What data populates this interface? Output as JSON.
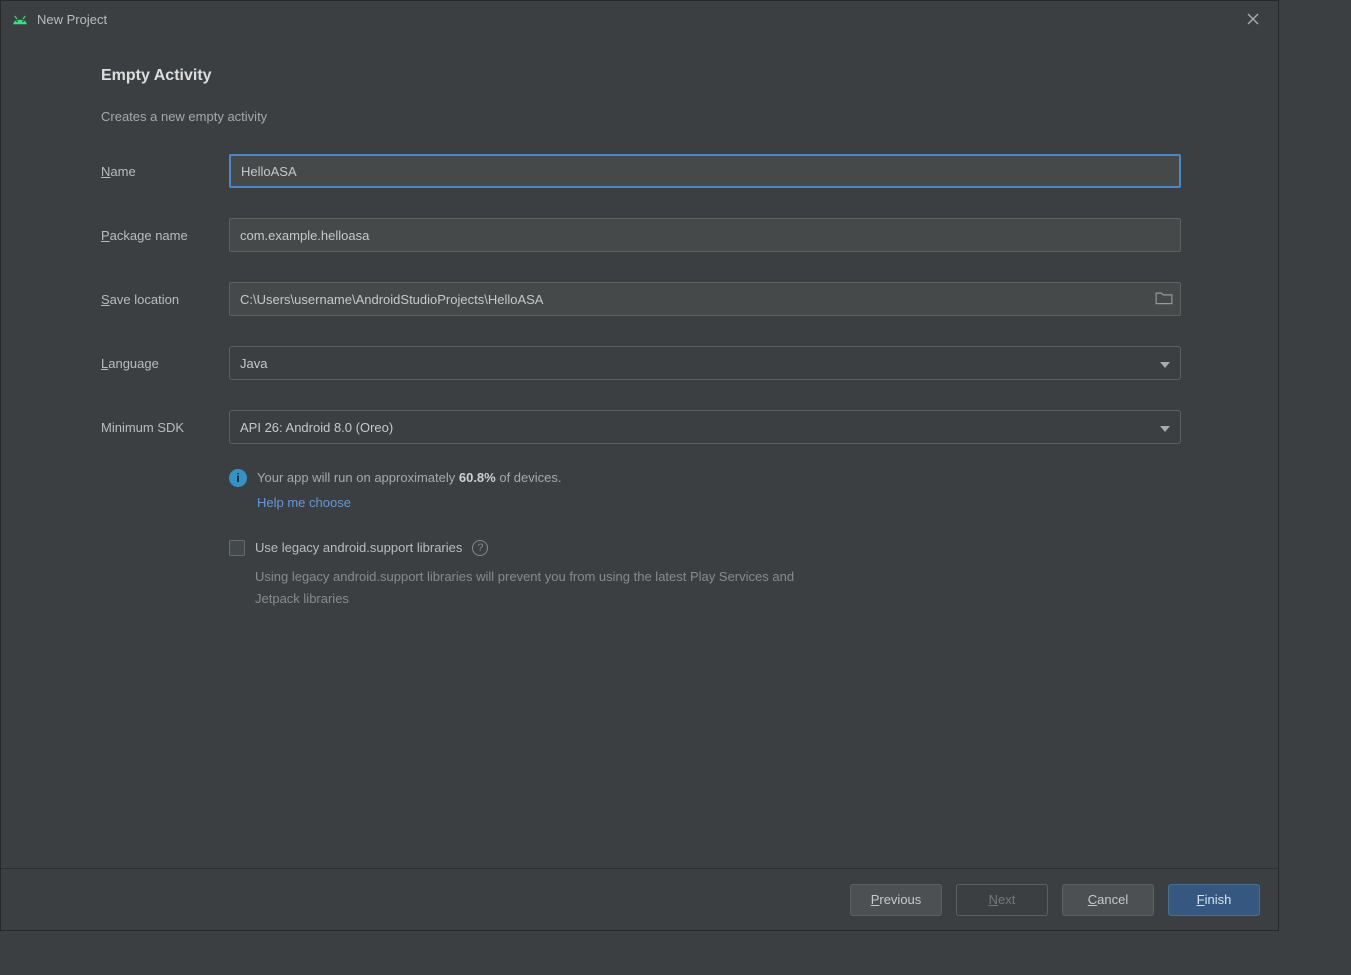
{
  "window": {
    "title": "New Project"
  },
  "page": {
    "heading": "Empty Activity",
    "subheading": "Creates a new empty activity"
  },
  "form": {
    "name": {
      "label_pre": "N",
      "label_rest": "ame",
      "value": "HelloASA"
    },
    "package": {
      "label_pre": "P",
      "label_rest": "ackage name",
      "value": "com.example.helloasa"
    },
    "save": {
      "label_pre": "S",
      "label_rest": "ave location",
      "value": "C:\\Users\\username\\AndroidStudioProjects\\HelloASA"
    },
    "language": {
      "label_pre": "L",
      "label_rest": "anguage",
      "value": "Java"
    },
    "minsdk": {
      "label": "Minimum SDK",
      "value": "API 26: Android 8.0 (Oreo)"
    }
  },
  "info": {
    "text_pre": "Your app will run on approximately ",
    "percent": "60.8%",
    "text_post": " of devices.",
    "help_link": "Help me choose"
  },
  "legacy": {
    "label": "Use legacy android.support libraries",
    "note": "Using legacy android.support libraries will prevent you from using the latest Play Services and Jetpack libraries"
  },
  "buttons": {
    "previous": "Previous",
    "next": "Next",
    "cancel": "Cancel",
    "finish": "Finish"
  }
}
